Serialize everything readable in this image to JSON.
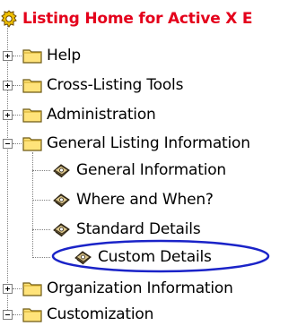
{
  "tree": {
    "root": {
      "label": "Listing Home for Active X E",
      "icon": "home-gear-icon",
      "color": "#e4001b"
    },
    "items": [
      {
        "label": "Help",
        "icon": "folder-icon",
        "state": "collapsed"
      },
      {
        "label": "Cross-Listing Tools",
        "icon": "folder-icon",
        "state": "collapsed"
      },
      {
        "label": "Administration",
        "icon": "folder-icon",
        "state": "collapsed"
      },
      {
        "label": "General Listing Information",
        "icon": "folder-icon",
        "state": "expanded",
        "children": [
          {
            "label": "General Information",
            "icon": "gear-icon"
          },
          {
            "label": "Where and When?",
            "icon": "gear-icon"
          },
          {
            "label": "Standard Details",
            "icon": "gear-icon"
          },
          {
            "label": "Custom Details",
            "icon": "gear-icon",
            "highlighted": true
          }
        ]
      },
      {
        "label": "Organization Information",
        "icon": "folder-icon",
        "state": "collapsed"
      },
      {
        "label": "Customization",
        "icon": "folder-icon",
        "state": "expanded"
      }
    ],
    "highlight_color": "#1a23c8"
  }
}
